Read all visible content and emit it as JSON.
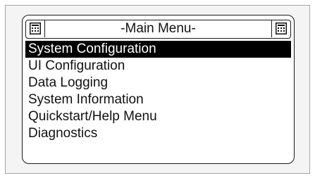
{
  "title_bar": {
    "title": "-Main Menu-",
    "left_icon": "document-icon",
    "right_icon": "document-icon"
  },
  "menu": {
    "items": [
      {
        "label": "System Configuration",
        "selected": true
      },
      {
        "label": "UI Configuration",
        "selected": false
      },
      {
        "label": "Data Logging",
        "selected": false
      },
      {
        "label": "System Information",
        "selected": false
      },
      {
        "label": "Quickstart/Help Menu",
        "selected": false
      },
      {
        "label": "Diagnostics",
        "selected": false
      }
    ]
  },
  "colors": {
    "selection_background": "#000000",
    "selection_text": "#ffffff",
    "frame_background": "#f4f4f4"
  }
}
